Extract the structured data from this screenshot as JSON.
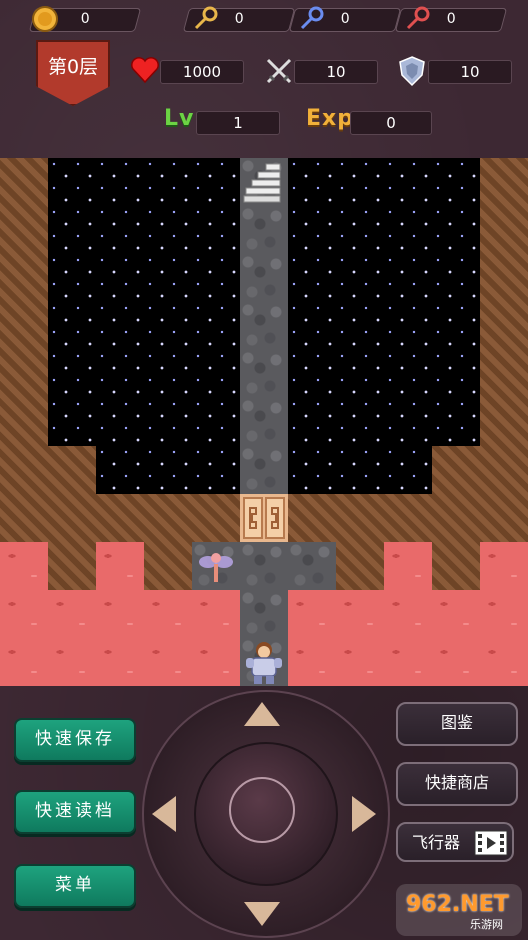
{
  "resources": {
    "gold": "0",
    "yellow_key": "0",
    "blue_key": "0",
    "red_key": "0"
  },
  "floor": {
    "label": "第0层"
  },
  "stats": {
    "hp": "1000",
    "attack": "10",
    "defense": "10",
    "lv_label": "Lv",
    "lv": "1",
    "exp_label": "Exp",
    "exp": "0"
  },
  "colors": {
    "accent_green": "#1ea37e",
    "floor_badge": "#b23a2c",
    "lava": "#e96a6a",
    "lv_text": "#6cd344",
    "exp_text": "#f2b13a"
  },
  "buttons": {
    "quick_save": "快速保存",
    "quick_load": "快速读档",
    "menu": "菜单",
    "monster_book": "图鉴",
    "quick_shop": "快捷商店",
    "fly": "飞行器"
  },
  "icons": {
    "gold": "coin-icon",
    "yellow_key": "yellow-key-icon",
    "blue_key": "blue-key-icon",
    "red_key": "red-key-icon",
    "hp": "heart-icon",
    "attack": "crossed-swords-icon",
    "defense": "shield-icon",
    "fly": "film-icon"
  },
  "watermark": {
    "brand": "962.NET",
    "sub": "乐游网"
  }
}
